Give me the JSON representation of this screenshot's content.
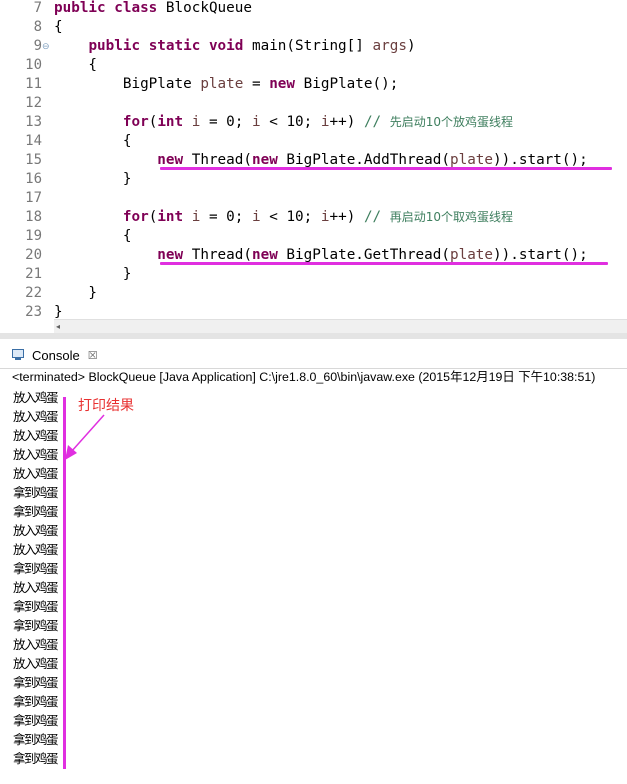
{
  "editor": {
    "line_numbers": [
      "7",
      "8",
      "9",
      "10",
      "11",
      "12",
      "13",
      "14",
      "15",
      "16",
      "17",
      "18",
      "19",
      "20",
      "21",
      "22",
      "23"
    ],
    "fold_marker": "⊖",
    "lines": [
      {
        "segs": [
          {
            "t": "public class",
            "c": "kw"
          },
          {
            "t": " BlockQueue",
            "c": ""
          }
        ]
      },
      {
        "segs": [
          {
            "t": "{",
            "c": ""
          }
        ]
      },
      {
        "segs": [
          {
            "t": "    ",
            "c": ""
          },
          {
            "t": "public static void",
            "c": "kw"
          },
          {
            "t": " main(String[] ",
            "c": ""
          },
          {
            "t": "args",
            "c": "var"
          },
          {
            "t": ")",
            "c": ""
          }
        ]
      },
      {
        "segs": [
          {
            "t": "    {",
            "c": ""
          }
        ]
      },
      {
        "segs": [
          {
            "t": "        BigPlate ",
            "c": ""
          },
          {
            "t": "plate",
            "c": "var"
          },
          {
            "t": " = ",
            "c": ""
          },
          {
            "t": "new",
            "c": "kw"
          },
          {
            "t": " BigPlate();",
            "c": ""
          }
        ]
      },
      {
        "segs": [
          {
            "t": "",
            "c": ""
          }
        ]
      },
      {
        "segs": [
          {
            "t": "        ",
            "c": ""
          },
          {
            "t": "for",
            "c": "kw"
          },
          {
            "t": "(",
            "c": ""
          },
          {
            "t": "int",
            "c": "kw"
          },
          {
            "t": " ",
            "c": ""
          },
          {
            "t": "i",
            "c": "var"
          },
          {
            "t": " = 0; ",
            "c": ""
          },
          {
            "t": "i",
            "c": "var"
          },
          {
            "t": " < 10; ",
            "c": ""
          },
          {
            "t": "i",
            "c": "var"
          },
          {
            "t": "++) ",
            "c": ""
          },
          {
            "t": "// ",
            "c": "cm"
          },
          {
            "t": "先启动10个放鸡蛋线程",
            "c": "cm cmz"
          }
        ]
      },
      {
        "segs": [
          {
            "t": "        {",
            "c": ""
          }
        ]
      },
      {
        "segs": [
          {
            "t": "            ",
            "c": ""
          },
          {
            "t": "new",
            "c": "kw"
          },
          {
            "t": " Thread(",
            "c": ""
          },
          {
            "t": "new",
            "c": "kw"
          },
          {
            "t": " BigPlate.AddThread(",
            "c": ""
          },
          {
            "t": "plate",
            "c": "var"
          },
          {
            "t": ")).start();",
            "c": ""
          }
        ]
      },
      {
        "segs": [
          {
            "t": "        }",
            "c": ""
          }
        ]
      },
      {
        "segs": [
          {
            "t": "",
            "c": ""
          }
        ]
      },
      {
        "segs": [
          {
            "t": "        ",
            "c": ""
          },
          {
            "t": "for",
            "c": "kw"
          },
          {
            "t": "(",
            "c": ""
          },
          {
            "t": "int",
            "c": "kw"
          },
          {
            "t": " ",
            "c": ""
          },
          {
            "t": "i",
            "c": "var"
          },
          {
            "t": " = 0; ",
            "c": ""
          },
          {
            "t": "i",
            "c": "var"
          },
          {
            "t": " < 10; ",
            "c": ""
          },
          {
            "t": "i",
            "c": "var"
          },
          {
            "t": "++) ",
            "c": ""
          },
          {
            "t": "// ",
            "c": "cm"
          },
          {
            "t": "再启动10个取鸡蛋线程",
            "c": "cm cmz"
          }
        ]
      },
      {
        "segs": [
          {
            "t": "        {",
            "c": ""
          }
        ]
      },
      {
        "segs": [
          {
            "t": "            ",
            "c": ""
          },
          {
            "t": "new",
            "c": "kw"
          },
          {
            "t": " Thread(",
            "c": ""
          },
          {
            "t": "new",
            "c": "kw"
          },
          {
            "t": " BigPlate.GetThread(",
            "c": ""
          },
          {
            "t": "plate",
            "c": "var"
          },
          {
            "t": ")).start();",
            "c": ""
          }
        ]
      },
      {
        "segs": [
          {
            "t": "        }",
            "c": ""
          }
        ]
      },
      {
        "segs": [
          {
            "t": "    }",
            "c": ""
          }
        ]
      },
      {
        "segs": [
          {
            "t": "}",
            "c": ""
          }
        ]
      }
    ]
  },
  "scrollbar": {
    "left_arrow": "◂"
  },
  "console": {
    "tab_label": "Console",
    "close_glyph": "☒",
    "status": "<terminated> BlockQueue [Java Application] C:\\jre1.8.0_60\\bin\\javaw.exe (2015年12月19日 下午10:38:51)",
    "output": [
      "放入鸡蛋",
      "放入鸡蛋",
      "放入鸡蛋",
      "放入鸡蛋",
      "放入鸡蛋",
      "拿到鸡蛋",
      "拿到鸡蛋",
      "放入鸡蛋",
      "放入鸡蛋",
      "拿到鸡蛋",
      "放入鸡蛋",
      "拿到鸡蛋",
      "拿到鸡蛋",
      "放入鸡蛋",
      "放入鸡蛋",
      "拿到鸡蛋",
      "拿到鸡蛋",
      "拿到鸡蛋",
      "拿到鸡蛋",
      "拿到鸡蛋"
    ]
  },
  "annotation": {
    "text": "打印结果",
    "color": "#e83030",
    "mark_color": "#e02fe0"
  },
  "colors": {
    "keyword": "#7f0055",
    "variable": "#6a3e3e",
    "comment": "#3f7f5f",
    "line_number": "#787878"
  }
}
